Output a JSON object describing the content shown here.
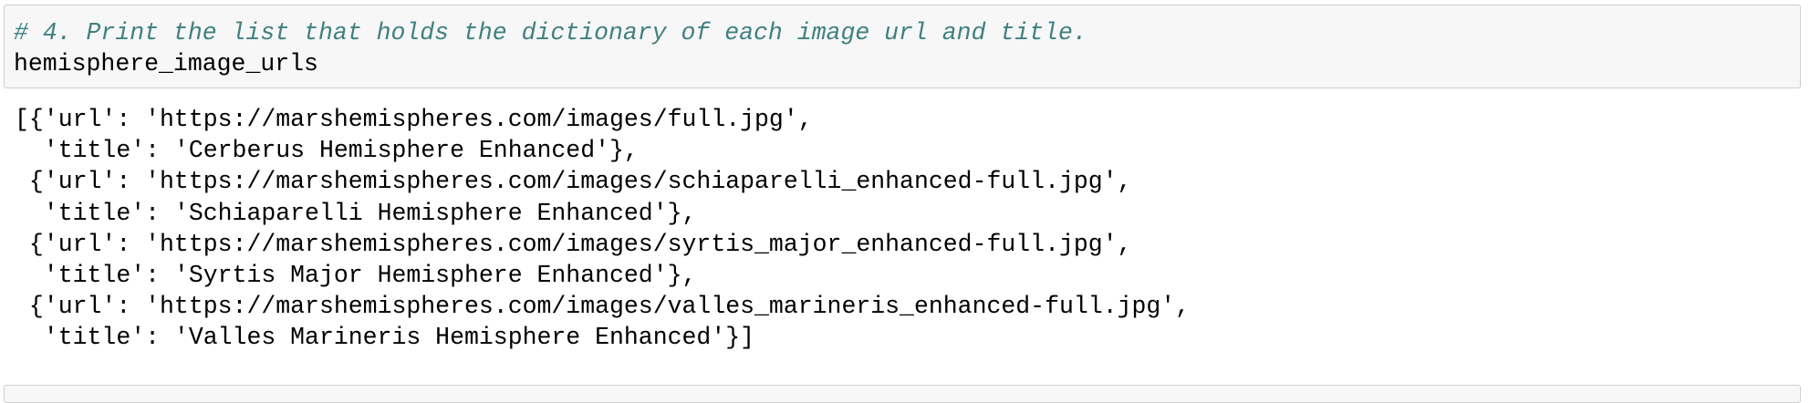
{
  "input_cell": {
    "comment": "# 4. Print the list that holds the dictionary of each image url and title.",
    "code": "hemisphere_image_urls"
  },
  "output_cell": {
    "lines": [
      "[{'url': 'https://marshemispheres.com/images/full.jpg',",
      "  'title': 'Cerberus Hemisphere Enhanced'},",
      " {'url': 'https://marshemispheres.com/images/schiaparelli_enhanced-full.jpg',",
      "  'title': 'Schiaparelli Hemisphere Enhanced'},",
      " {'url': 'https://marshemispheres.com/images/syrtis_major_enhanced-full.jpg',",
      "  'title': 'Syrtis Major Hemisphere Enhanced'},",
      " {'url': 'https://marshemispheres.com/images/valles_marineris_enhanced-full.jpg',",
      "  'title': 'Valles Marineris Hemisphere Enhanced'}]"
    ]
  },
  "colors": {
    "comment": "#408080",
    "cell_background": "#f7f7f7",
    "cell_border": "#cfcfcf",
    "text": "#000000"
  }
}
